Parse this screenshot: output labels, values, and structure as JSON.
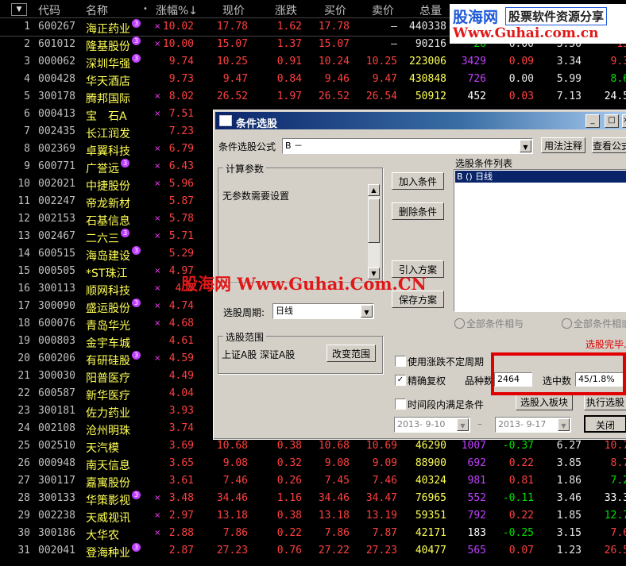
{
  "header": {
    "sort_icon": "▼",
    "columns": [
      "代码",
      "名称",
      "•",
      "涨幅%↓",
      "现价",
      "涨跌",
      "买价",
      "卖价",
      "总量"
    ]
  },
  "rows": [
    {
      "n": "1",
      "code": "600267",
      "name": "海正药业",
      "badge": "3",
      "x": "×",
      "pct": "10.02",
      "price": "17.78",
      "chg": "1.62",
      "bid": "17.78",
      "ask": "–",
      "vol": "440338",
      "c1": "",
      "c2": "",
      "c3": "",
      "c4": ""
    },
    {
      "n": "2",
      "code": "601012",
      "name": "隆基股份",
      "badge": "3",
      "x": "×",
      "pct": "10.00",
      "price": "15.07",
      "chg": "1.37",
      "bid": "15.07",
      "ask": "–",
      "vol": "90216",
      "c1": "26",
      "c2": "0.00",
      "c3": "3.56",
      "c4": "13"
    },
    {
      "n": "3",
      "code": "000062",
      "name": "深圳华强",
      "badge": "3",
      "x": "",
      "pct": "9.74",
      "price": "10.25",
      "chg": "0.91",
      "bid": "10.24",
      "ask": "10.25",
      "vol": "223006",
      "c1": "3429",
      "c2": "0.09",
      "c3": "3.34",
      "c4": "9.3"
    },
    {
      "n": "4",
      "code": "000428",
      "name": "华天酒店",
      "badge": "",
      "x": "",
      "pct": "9.73",
      "price": "9.47",
      "chg": "0.84",
      "bid": "9.46",
      "ask": "9.47",
      "vol": "430848",
      "c1": "726",
      "c2": "0.00",
      "c3": "5.99",
      "c4": "8.6"
    },
    {
      "n": "5",
      "code": "300178",
      "name": "腾邦国际",
      "badge": "",
      "x": "×",
      "pct": "8.02",
      "price": "26.52",
      "chg": "1.97",
      "bid": "26.52",
      "ask": "26.54",
      "vol": "50912",
      "c1": "452",
      "c2": "0.03",
      "c3": "7.13",
      "c4": "24.5"
    },
    {
      "n": "6",
      "code": "000413",
      "name": "宝　石A",
      "badge": "",
      "x": "×",
      "pct": "7.51",
      "price": "",
      "chg": "",
      "bid": "",
      "ask": "",
      "vol": "",
      "c1": "",
      "c2": "",
      "c3": "",
      "c4": ""
    },
    {
      "n": "7",
      "code": "002435",
      "name": "长江润发",
      "badge": "",
      "x": "",
      "pct": "7.23",
      "price": "",
      "chg": "",
      "bid": "",
      "ask": "",
      "vol": "",
      "c1": "",
      "c2": "",
      "c3": "",
      "c4": ""
    },
    {
      "n": "8",
      "code": "002369",
      "name": "卓翼科技",
      "badge": "",
      "x": "×",
      "pct": "6.79",
      "price": "",
      "chg": "",
      "bid": "",
      "ask": "",
      "vol": "",
      "c1": "",
      "c2": "",
      "c3": "",
      "c4": ""
    },
    {
      "n": "9",
      "code": "600771",
      "name": "广誉远",
      "badge": "3",
      "x": "×",
      "pct": "6.43",
      "price": "",
      "chg": "",
      "bid": "",
      "ask": "",
      "vol": "",
      "c1": "",
      "c2": "",
      "c3": "",
      "c4": ""
    },
    {
      "n": "10",
      "code": "002021",
      "name": "中捷股份",
      "badge": "",
      "x": "×",
      "pct": "5.96",
      "price": "",
      "chg": "",
      "bid": "",
      "ask": "",
      "vol": "",
      "c1": "",
      "c2": "",
      "c3": "",
      "c4": ""
    },
    {
      "n": "11",
      "code": "002247",
      "name": "帝龙新材",
      "badge": "",
      "x": "",
      "pct": "5.87",
      "price": "",
      "chg": "",
      "bid": "",
      "ask": "",
      "vol": "",
      "c1": "",
      "c2": "",
      "c3": "",
      "c4": ""
    },
    {
      "n": "12",
      "code": "002153",
      "name": "石基信息",
      "badge": "",
      "x": "×",
      "pct": "5.78",
      "price": "",
      "chg": "",
      "bid": "",
      "ask": "",
      "vol": "",
      "c1": "",
      "c2": "",
      "c3": "",
      "c4": ""
    },
    {
      "n": "13",
      "code": "002467",
      "name": "二六三",
      "badge": "3",
      "x": "×",
      "pct": "5.71",
      "price": "",
      "chg": "",
      "bid": "",
      "ask": "",
      "vol": "",
      "c1": "",
      "c2": "",
      "c3": "",
      "c4": ""
    },
    {
      "n": "14",
      "code": "600515",
      "name": "海岛建设",
      "badge": "3",
      "x": "",
      "pct": "5.29",
      "price": "",
      "chg": "",
      "bid": "",
      "ask": "",
      "vol": "",
      "c1": "",
      "c2": "",
      "c3": "",
      "c4": ""
    },
    {
      "n": "15",
      "code": "000505",
      "name": "*ST珠江",
      "badge": "",
      "x": "×",
      "pct": "4.97",
      "price": "",
      "chg": "",
      "bid": "",
      "ask": "",
      "vol": "",
      "c1": "",
      "c2": "",
      "c3": "",
      "c4": ""
    },
    {
      "n": "16",
      "code": "300113",
      "name": "顺网科技",
      "badge": "",
      "x": "×",
      "pct": "4.8",
      "price": "",
      "chg": "",
      "bid": "",
      "ask": "",
      "vol": "",
      "c1": "",
      "c2": "",
      "c3": "",
      "c4": ""
    },
    {
      "n": "17",
      "code": "300090",
      "name": "盛运股份",
      "badge": "3",
      "x": "×",
      "pct": "4.74",
      "price": "",
      "chg": "",
      "bid": "",
      "ask": "",
      "vol": "",
      "c1": "",
      "c2": "",
      "c3": "",
      "c4": ""
    },
    {
      "n": "18",
      "code": "600076",
      "name": "青岛华光",
      "badge": "",
      "x": "×",
      "pct": "4.68",
      "price": "",
      "chg": "",
      "bid": "",
      "ask": "",
      "vol": "",
      "c1": "",
      "c2": "",
      "c3": "",
      "c4": ""
    },
    {
      "n": "19",
      "code": "000803",
      "name": "金宇车城",
      "badge": "",
      "x": "",
      "pct": "4.61",
      "price": "",
      "chg": "",
      "bid": "",
      "ask": "",
      "vol": "",
      "c1": "",
      "c2": "",
      "c3": "",
      "c4": ""
    },
    {
      "n": "20",
      "code": "600206",
      "name": "有研硅股",
      "badge": "3",
      "x": "×",
      "pct": "4.59",
      "price": "",
      "chg": "",
      "bid": "",
      "ask": "",
      "vol": "",
      "c1": "",
      "c2": "",
      "c3": "",
      "c4": ""
    },
    {
      "n": "21",
      "code": "300030",
      "name": "阳普医疗",
      "badge": "",
      "x": "",
      "pct": "4.49",
      "price": "",
      "chg": "",
      "bid": "",
      "ask": "",
      "vol": "",
      "c1": "",
      "c2": "",
      "c3": "",
      "c4": ""
    },
    {
      "n": "22",
      "code": "600587",
      "name": "新华医疗",
      "badge": "",
      "x": "",
      "pct": "4.04",
      "price": "",
      "chg": "",
      "bid": "",
      "ask": "",
      "vol": "",
      "c1": "",
      "c2": "",
      "c3": "",
      "c4": ""
    },
    {
      "n": "23",
      "code": "300181",
      "name": "佐力药业",
      "badge": "",
      "x": "",
      "pct": "3.93",
      "price": "",
      "chg": "",
      "bid": "",
      "ask": "",
      "vol": "",
      "c1": "",
      "c2": "",
      "c3": "",
      "c4": ""
    },
    {
      "n": "24",
      "code": "002108",
      "name": "沧州明珠",
      "badge": "",
      "x": "",
      "pct": "3.74",
      "price": "",
      "chg": "",
      "bid": "",
      "ask": "",
      "vol": "",
      "c1": "",
      "c2": "",
      "c3": "",
      "c4": ""
    },
    {
      "n": "25",
      "code": "002510",
      "name": "天汽模",
      "badge": "",
      "x": "",
      "pct": "3.69",
      "price": "10.68",
      "chg": "0.38",
      "bid": "10.68",
      "ask": "10.69",
      "vol": "46290",
      "c1": "1007",
      "c2": "-0.37",
      "c3": "6.27",
      "c4": "10.7"
    },
    {
      "n": "26",
      "code": "000948",
      "name": "南天信息",
      "badge": "",
      "x": "",
      "pct": "3.65",
      "price": "9.08",
      "chg": "0.32",
      "bid": "9.08",
      "ask": "9.09",
      "vol": "88900",
      "c1": "692",
      "c2": "0.22",
      "c3": "3.85",
      "c4": "8.7"
    },
    {
      "n": "27",
      "code": "300117",
      "name": "嘉寓股份",
      "badge": "",
      "x": "",
      "pct": "3.61",
      "price": "7.46",
      "chg": "0.26",
      "bid": "7.45",
      "ask": "7.46",
      "vol": "40324",
      "c1": "981",
      "c2": "0.81",
      "c3": "1.86",
      "c4": "7.2"
    },
    {
      "n": "28",
      "code": "300133",
      "name": "华策影视",
      "badge": "3",
      "x": "×",
      "pct": "3.48",
      "price": "34.46",
      "chg": "1.16",
      "bid": "34.46",
      "ask": "34.47",
      "vol": "76965",
      "c1": "552",
      "c2": "-0.11",
      "c3": "3.46",
      "c4": "33.3"
    },
    {
      "n": "29",
      "code": "002238",
      "name": "天威视讯",
      "badge": "",
      "x": "×",
      "pct": "2.97",
      "price": "13.18",
      "chg": "0.38",
      "bid": "13.18",
      "ask": "13.19",
      "vol": "59351",
      "c1": "792",
      "c2": "0.22",
      "c3": "1.85",
      "c4": "12.7"
    },
    {
      "n": "30",
      "code": "300186",
      "name": "大华农",
      "badge": "",
      "x": "×",
      "pct": "2.88",
      "price": "7.86",
      "chg": "0.22",
      "bid": "7.86",
      "ask": "7.87",
      "vol": "42171",
      "c1": "183",
      "c2": "-0.25",
      "c3": "3.15",
      "c4": "7.6"
    },
    {
      "n": "31",
      "code": "002041",
      "name": "登海种业",
      "badge": "3",
      "x": "",
      "pct": "2.87",
      "price": "27.23",
      "chg": "0.76",
      "bid": "27.22",
      "ask": "27.23",
      "vol": "40477",
      "c1": "565",
      "c2": "0.07",
      "c3": "1.23",
      "c4": "26.5"
    }
  ],
  "watermark": {
    "cn": "股海网",
    "tag": "股票软件资源分享",
    "url": "Www.Guhai.com.cn"
  },
  "mid_watermark": "股海网 Www.Guhai.Com.CN",
  "dialog": {
    "title": "条件选股",
    "formula_label": "条件选股公式",
    "formula_value": "B        －",
    "btn_usage": "用法注释",
    "btn_view": "查看公式",
    "params_group": "计算参数",
    "params_text": "无参数需要设置",
    "btn_add": "加入条件",
    "btn_del": "删除条件",
    "btn_import": "引入方案",
    "btn_save": "保存方案",
    "list_label": "选股条件列表",
    "list_items": [
      "B  ()  日线"
    ],
    "period_label": "选股周期:",
    "period_value": "日线",
    "radio_and": "全部条件相与",
    "radio_or": "全部条件相或",
    "done": "选股完毕.",
    "range_group": "选股范围",
    "range_text": "上证A股 深证A股",
    "btn_range": "改变范围",
    "chk_uncertain": "使用涨跌不定周期",
    "chk_adjust": "精确复权",
    "count_label": "品种数",
    "count_value": "2464",
    "selected_label": "选中数",
    "selected_value": "45/1.8%",
    "chk_period": "时间段内满足条件",
    "btn_board": "选股入板块",
    "btn_run": "执行选股",
    "date_from": "2013- 9-10",
    "date_to": "2013- 9-17",
    "btn_close": "关闭"
  }
}
